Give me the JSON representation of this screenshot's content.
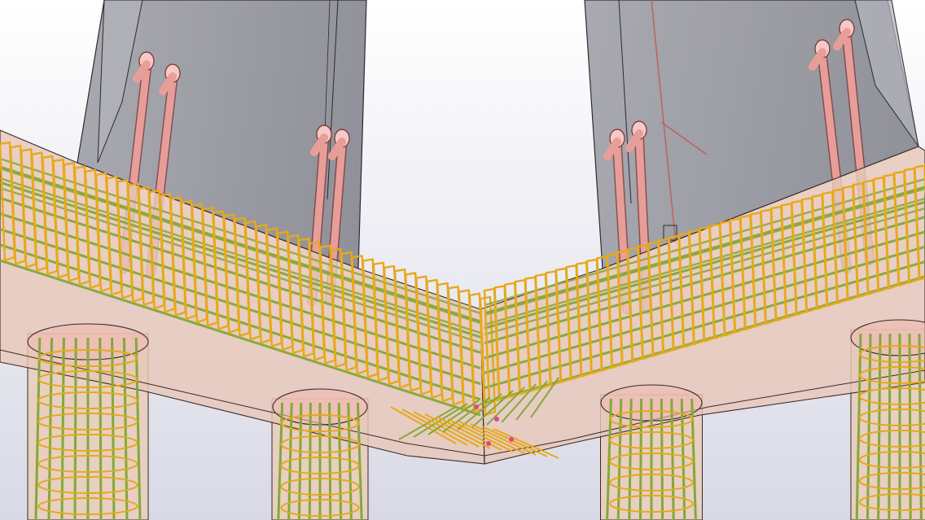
{
  "scene": {
    "kind": "3d-rebar-model-view",
    "colors": {
      "sky_top": "#ffffff",
      "sky_bottom": "#d9d9e6",
      "wall": "#8f8f97",
      "wall_edge": "#2a2a30",
      "slab": "#e7c7b8",
      "slab_edge": "#3a2a26",
      "pile": "#e8cdbd",
      "stirrup": "#e6a91a",
      "long_bar": "#84a83a",
      "duct": "#e89e98",
      "duct_edge": "#7a2e2e",
      "accent_pink": "#e0448c"
    },
    "icons": [
      "rebar-cage",
      "pile-cap",
      "duct-sleeve"
    ]
  }
}
